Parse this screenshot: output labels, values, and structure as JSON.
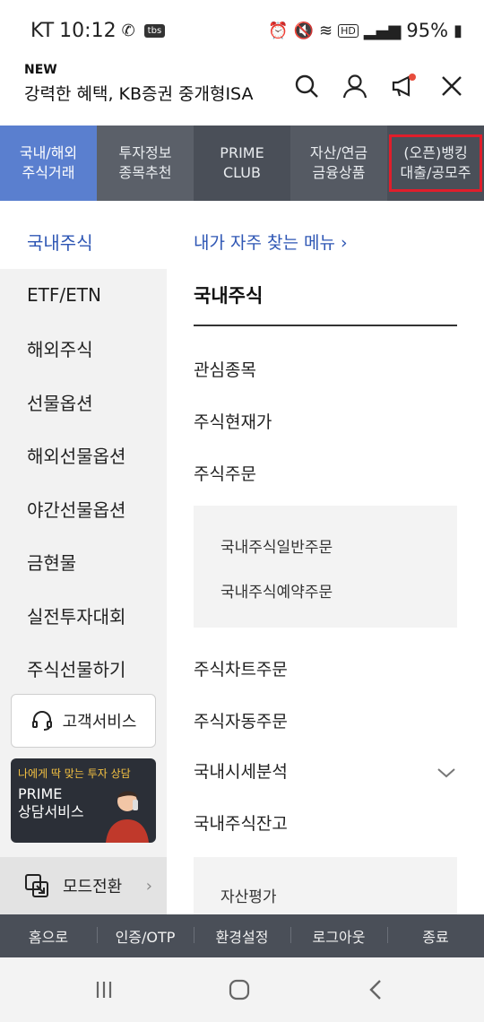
{
  "status": {
    "carrier": "KT",
    "time": "10:12",
    "tbs": "tbs",
    "hd": "HD",
    "battery": "95%"
  },
  "header": {
    "new_badge": "NEW",
    "title": "강력한 혜택, KB증권 중개형ISA",
    "icons": [
      "search-icon",
      "user-icon",
      "megaphone-icon",
      "close-icon"
    ]
  },
  "tabs": [
    {
      "label1": "국내/해외",
      "label2": "주식거래"
    },
    {
      "label1": "투자정보",
      "label2": "종목추천"
    },
    {
      "label1": "PRIME",
      "label2": "CLUB"
    },
    {
      "label1": "자산/연금",
      "label2": "금융상품"
    },
    {
      "label1": "(오픈)뱅킹",
      "label2": "대출/공모주"
    }
  ],
  "leftnav": {
    "items": [
      "국내주식",
      "ETF/ETN",
      "해외주식",
      "선물옵션",
      "해외선물옵션",
      "야간선물옵션",
      "금현물",
      "실전투자대회",
      "주식선물하기"
    ],
    "customer_service": "고객서비스",
    "banner_tag": "나에게 딱 맞는 투자 상담",
    "banner_title1": "PRIME",
    "banner_title2": "상담서비스",
    "mode_switch": "모드전환"
  },
  "content": {
    "fav_menu": "내가 자주 찾는 메뉴",
    "section_title": "국내주식",
    "items": {
      "watch": "관심종목",
      "price": "주식현재가",
      "order": "주식주문",
      "sub_general": "국내주식일반주문",
      "sub_reserve": "국내주식예약주문",
      "chart_order": "주식차트주문",
      "auto_order": "주식자동주문",
      "analysis": "국내시세분석",
      "balance": "국내주식잔고",
      "sub_asset": "자산평가"
    }
  },
  "bottombar": [
    "홈으로",
    "인증/OTP",
    "환경설정",
    "로그아웃",
    "종료"
  ],
  "colors": {
    "accent_blue": "#2e56b4",
    "active_tab": "#5a7fcf",
    "dark_bar": "#4a4f58",
    "highlight_red": "#e01e2b"
  }
}
